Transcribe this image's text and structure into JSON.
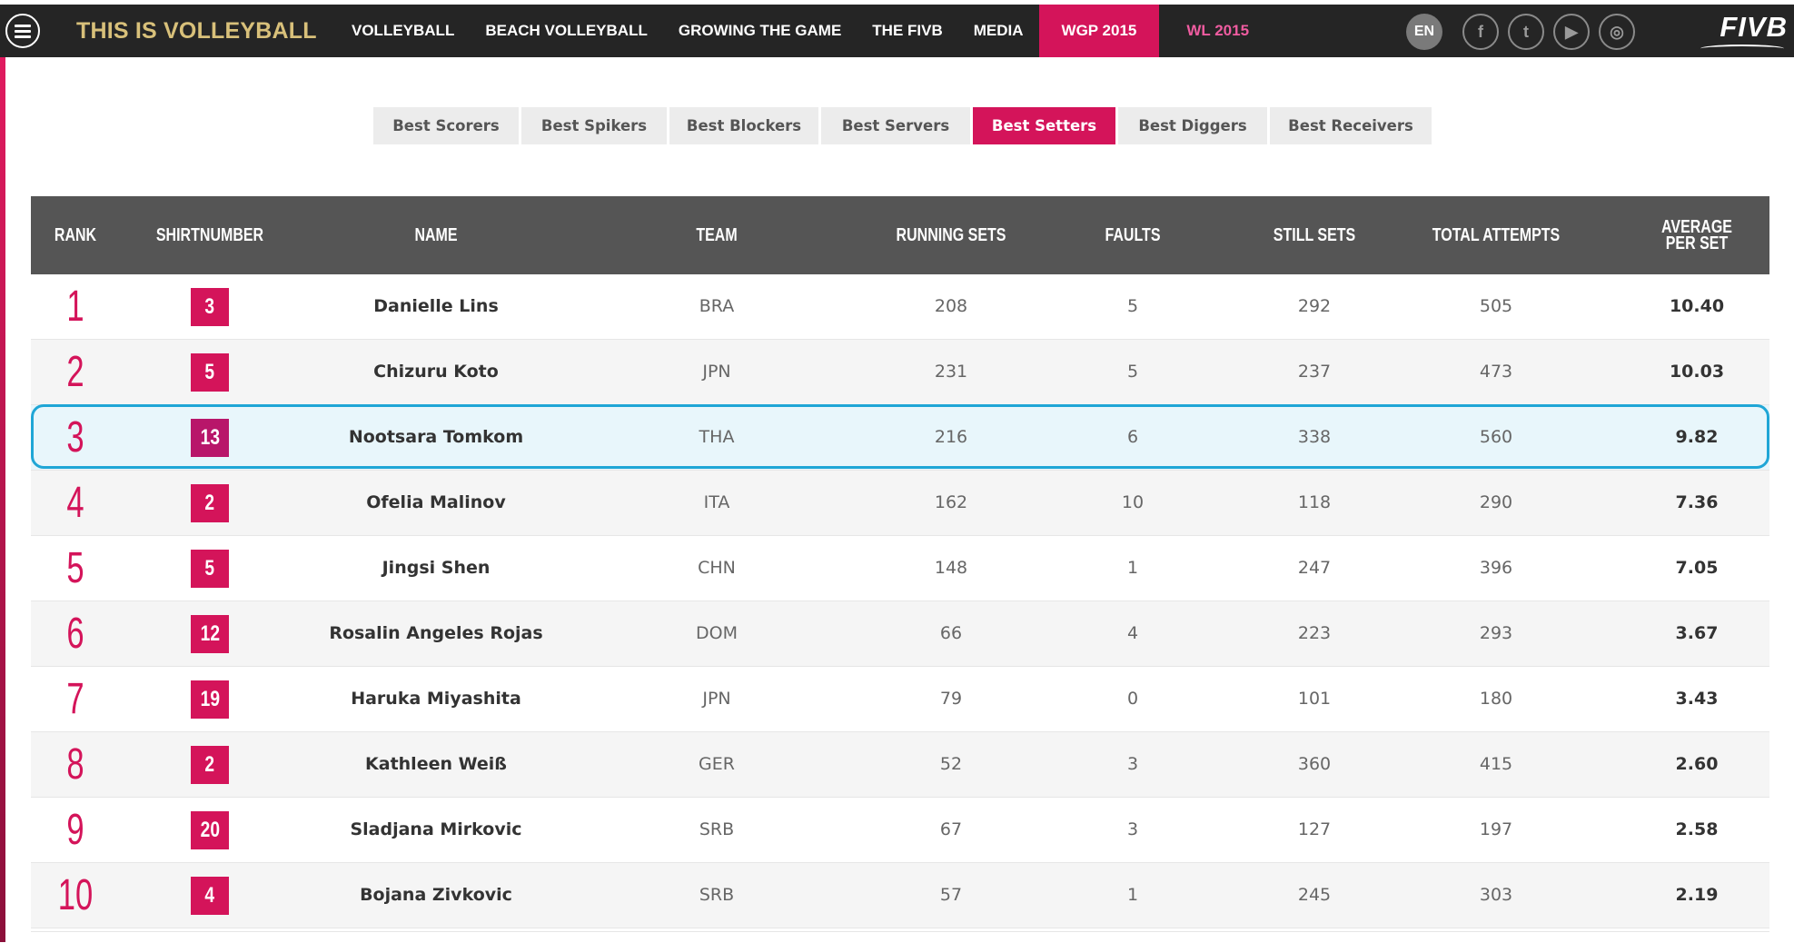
{
  "header": {
    "brand": "THIS IS VOLLEYBALL",
    "nav": [
      {
        "label": "VOLLEYBALL",
        "state": "normal"
      },
      {
        "label": "BEACH VOLLEYBALL",
        "state": "normal"
      },
      {
        "label": "GROWING THE GAME",
        "state": "normal"
      },
      {
        "label": "THE FIVB",
        "state": "normal"
      },
      {
        "label": "MEDIA",
        "state": "normal"
      },
      {
        "label": "WGP 2015",
        "state": "active"
      },
      {
        "label": "WL 2015",
        "state": "pink"
      }
    ],
    "language": "EN",
    "social": [
      {
        "icon": "facebook-icon",
        "glyph": "f"
      },
      {
        "icon": "twitter-icon",
        "glyph": "t"
      },
      {
        "icon": "youtube-icon",
        "glyph": "▶"
      },
      {
        "icon": "instagram-icon",
        "glyph": "◎"
      }
    ],
    "logo": "FIVB"
  },
  "tabs": [
    {
      "label": "Best Scorers",
      "active": false
    },
    {
      "label": "Best Spikers",
      "active": false
    },
    {
      "label": "Best Blockers",
      "active": false
    },
    {
      "label": "Best Servers",
      "active": false
    },
    {
      "label": "Best Setters",
      "active": true
    },
    {
      "label": "Best Diggers",
      "active": false
    },
    {
      "label": "Best Receivers",
      "active": false
    }
  ],
  "table": {
    "columns": [
      "RANK",
      "SHIRTNUMBER",
      "NAME",
      "TEAM",
      "RUNNING SETS",
      "FAULTS",
      "STILL SETS",
      "TOTAL ATTEMPTS",
      "AVERAGE PER SET"
    ],
    "highlighted_rank": 3,
    "rows": [
      {
        "rank": "1",
        "shirt": "3",
        "name": "Danielle Lins",
        "team": "BRA",
        "running_sets": "208",
        "faults": "5",
        "still_sets": "292",
        "total_attempts": "505",
        "average": "10.40"
      },
      {
        "rank": "2",
        "shirt": "5",
        "name": "Chizuru Koto",
        "team": "JPN",
        "running_sets": "231",
        "faults": "5",
        "still_sets": "237",
        "total_attempts": "473",
        "average": "10.03"
      },
      {
        "rank": "3",
        "shirt": "13",
        "name": "Nootsara Tomkom",
        "team": "THA",
        "running_sets": "216",
        "faults": "6",
        "still_sets": "338",
        "total_attempts": "560",
        "average": "9.82"
      },
      {
        "rank": "4",
        "shirt": "2",
        "name": "Ofelia Malinov",
        "team": "ITA",
        "running_sets": "162",
        "faults": "10",
        "still_sets": "118",
        "total_attempts": "290",
        "average": "7.36"
      },
      {
        "rank": "5",
        "shirt": "5",
        "name": "Jingsi Shen",
        "team": "CHN",
        "running_sets": "148",
        "faults": "1",
        "still_sets": "247",
        "total_attempts": "396",
        "average": "7.05"
      },
      {
        "rank": "6",
        "shirt": "12",
        "name": "Rosalin Angeles Rojas",
        "team": "DOM",
        "running_sets": "66",
        "faults": "4",
        "still_sets": "223",
        "total_attempts": "293",
        "average": "3.67"
      },
      {
        "rank": "7",
        "shirt": "19",
        "name": "Haruka Miyashita",
        "team": "JPN",
        "running_sets": "79",
        "faults": "0",
        "still_sets": "101",
        "total_attempts": "180",
        "average": "3.43"
      },
      {
        "rank": "8",
        "shirt": "2",
        "name": "Kathleen Weiß",
        "team": "GER",
        "running_sets": "52",
        "faults": "3",
        "still_sets": "360",
        "total_attempts": "415",
        "average": "2.60"
      },
      {
        "rank": "9",
        "shirt": "20",
        "name": "Sladjana Mirkovic",
        "team": "SRB",
        "running_sets": "67",
        "faults": "3",
        "still_sets": "127",
        "total_attempts": "197",
        "average": "2.58"
      },
      {
        "rank": "10",
        "shirt": "4",
        "name": "Bojana Zivkovic",
        "team": "SRB",
        "running_sets": "57",
        "faults": "1",
        "still_sets": "245",
        "total_attempts": "303",
        "average": "2.19"
      }
    ]
  },
  "colors": {
    "accent": "#d4145a",
    "header_bg": "#252525",
    "table_header_bg": "#555555",
    "highlight_border": "#1fa6d6",
    "highlight_bg": "#e8f6fb",
    "brand_gold": "#d8c07a"
  }
}
